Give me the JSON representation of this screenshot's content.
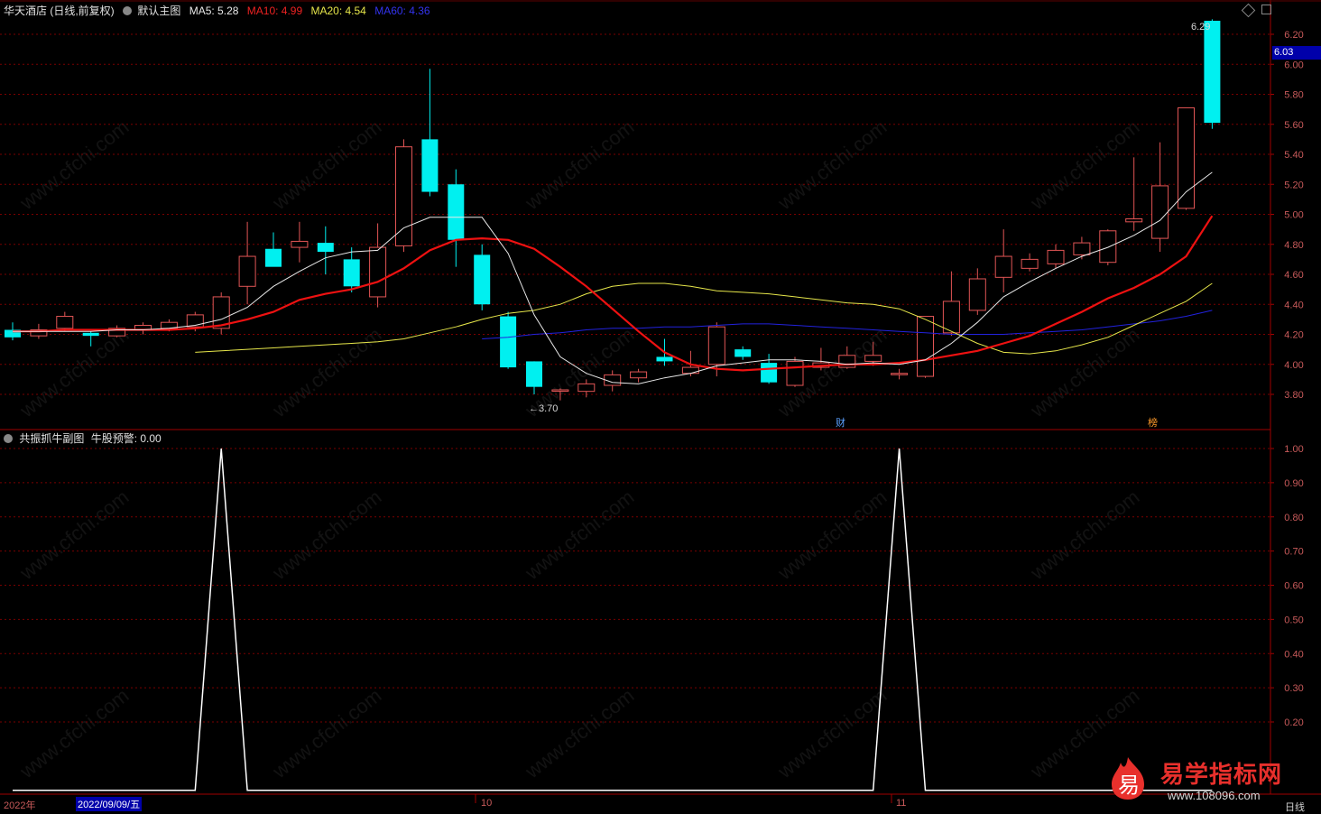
{
  "main_header": {
    "stock_title": "华天酒店 (日线,前复权)",
    "chart_name": "默认主图",
    "ma5_label": "MA5: 5.28",
    "ma10_label": "MA10: 4.99",
    "ma20_label": "MA20: 4.54",
    "ma60_label": "MA60: 4.36"
  },
  "sub_header": {
    "indicator_name": "共振抓牛副图",
    "indicator_value": "牛股预警: 0.00"
  },
  "bottom_axis": {
    "year_label": "2022年",
    "cursor_date": "2022/09/09/五",
    "month_oct": "10",
    "month_nov": "11",
    "period_label": "日线"
  },
  "price_tag": {
    "current": "6.03"
  },
  "annotations": {
    "low": "←3.70",
    "high": "6.29",
    "badge_cai": "财",
    "badge_bang": "榜"
  },
  "watermark": "www.cfchi.com",
  "brand": {
    "logo_char": "易",
    "name": "易学指标网",
    "url": "www.108096.com"
  },
  "colors": {
    "up": "#e25555",
    "down": "#00f0f0",
    "ma5": "#e8e8e8",
    "ma10": "#ee1111",
    "ma20": "#e6e64a",
    "ma60": "#2222dd",
    "grid": "#7a0000"
  },
  "chart_data": [
    {
      "type": "candlestick",
      "title": "华天酒店 (日线,前复权)",
      "ylim": [
        3.7,
        6.3
      ],
      "y_ticks": [
        "6.20",
        "6.00",
        "5.80",
        "5.60",
        "5.40",
        "5.20",
        "5.00",
        "4.80",
        "4.60",
        "4.40",
        "4.20",
        "4.00",
        "3.80"
      ],
      "candles_ohlc": [
        [
          4.23,
          4.18,
          4.28,
          4.16
        ],
        [
          4.19,
          4.23,
          4.27,
          4.17
        ],
        [
          4.24,
          4.32,
          4.35,
          4.22
        ],
        [
          4.21,
          4.19,
          4.22,
          4.12
        ],
        [
          4.19,
          4.24,
          4.26,
          4.18
        ],
        [
          4.23,
          4.26,
          4.28,
          4.2
        ],
        [
          4.24,
          4.28,
          4.3,
          4.22
        ],
        [
          4.25,
          4.33,
          4.35,
          4.22
        ],
        [
          4.24,
          4.45,
          4.48,
          4.2
        ],
        [
          4.52,
          4.72,
          4.95,
          4.4
        ],
        [
          4.77,
          4.65,
          4.88,
          4.7
        ],
        [
          4.78,
          4.82,
          4.95,
          4.68
        ],
        [
          4.81,
          4.75,
          4.92,
          4.6
        ],
        [
          4.7,
          4.52,
          4.78,
          4.48
        ],
        [
          4.45,
          4.78,
          4.94,
          4.38
        ],
        [
          4.79,
          5.45,
          5.5,
          4.75
        ],
        [
          5.5,
          5.15,
          5.97,
          5.12
        ],
        [
          5.2,
          4.83,
          5.3,
          4.65
        ],
        [
          4.73,
          4.4,
          4.8,
          4.36
        ],
        [
          4.32,
          3.98,
          4.35,
          3.97
        ],
        [
          4.02,
          3.85,
          4.02,
          3.8
        ],
        [
          3.83,
          3.83,
          3.84,
          3.76
        ],
        [
          3.82,
          3.87,
          3.9,
          3.78
        ],
        [
          3.86,
          3.93,
          3.96,
          3.82
        ],
        [
          3.91,
          3.95,
          3.97,
          3.88
        ],
        [
          4.05,
          4.02,
          4.17,
          3.99
        ],
        [
          3.94,
          3.98,
          4.09,
          3.92
        ],
        [
          4.0,
          4.25,
          4.28,
          3.92
        ],
        [
          4.1,
          4.05,
          4.12,
          4.03
        ],
        [
          4.01,
          3.88,
          4.07,
          3.87
        ],
        [
          3.86,
          4.02,
          4.05,
          3.85
        ],
        [
          3.98,
          4.01,
          4.11,
          3.96
        ],
        [
          3.98,
          4.06,
          4.12,
          3.97
        ],
        [
          4.02,
          4.06,
          4.15,
          3.99
        ],
        [
          3.94,
          3.94,
          3.97,
          3.9
        ],
        [
          3.92,
          4.32,
          4.32,
          3.91
        ],
        [
          4.21,
          4.42,
          4.62,
          4.19
        ],
        [
          4.36,
          4.57,
          4.64,
          4.33
        ],
        [
          4.58,
          4.72,
          4.9,
          4.48
        ],
        [
          4.64,
          4.7,
          4.74,
          4.62
        ],
        [
          4.67,
          4.76,
          4.8,
          4.64
        ],
        [
          4.73,
          4.81,
          4.85,
          4.7
        ],
        [
          4.68,
          4.89,
          4.9,
          4.66
        ],
        [
          4.95,
          4.97,
          5.38,
          4.89
        ],
        [
          4.84,
          5.19,
          5.48,
          4.75
        ],
        [
          5.04,
          5.71,
          5.7,
          5.03
        ],
        [
          6.29,
          5.61,
          6.3,
          5.57
        ]
      ],
      "ma5": [
        4.22,
        4.22,
        4.22,
        4.22,
        4.23,
        4.23,
        4.24,
        4.26,
        4.3,
        4.38,
        4.52,
        4.62,
        4.71,
        4.75,
        4.76,
        4.91,
        4.98,
        4.98,
        4.98,
        4.74,
        4.33,
        4.05,
        3.94,
        3.88,
        3.87,
        3.91,
        3.94,
        3.99,
        4.01,
        4.03,
        4.03,
        4.02,
        4.0,
        4.01,
        4.0,
        4.03,
        4.14,
        4.28,
        4.45,
        4.55,
        4.64,
        4.72,
        4.78,
        4.86,
        4.96,
        5.15,
        5.28
      ],
      "ma10": [
        4.22,
        4.22,
        4.23,
        4.23,
        4.23,
        4.23,
        4.23,
        4.24,
        4.26,
        4.3,
        4.35,
        4.43,
        4.47,
        4.5,
        4.55,
        4.64,
        4.76,
        4.83,
        4.84,
        4.83,
        4.77,
        4.65,
        4.52,
        4.37,
        4.22,
        4.08,
        4.0,
        3.97,
        3.96,
        3.97,
        3.98,
        3.99,
        4.0,
        4.0,
        4.01,
        4.03,
        4.06,
        4.09,
        4.14,
        4.19,
        4.27,
        4.35,
        4.44,
        4.51,
        4.6,
        4.72,
        4.99
      ],
      "ma20": [
        4.08,
        4.09,
        4.1,
        4.11,
        4.12,
        4.13,
        4.14,
        4.15,
        4.17,
        4.21,
        4.25,
        4.3,
        4.34,
        4.36,
        4.4,
        4.47,
        4.52,
        4.54,
        4.54,
        4.52,
        4.49,
        4.48,
        4.47,
        4.45,
        4.43,
        4.41,
        4.4,
        4.37,
        4.3,
        4.22,
        4.14,
        4.08,
        4.07,
        4.09,
        4.13,
        4.18,
        4.26,
        4.34,
        4.42,
        4.54
      ],
      "ma60": [
        4.17,
        4.18,
        4.2,
        4.21,
        4.23,
        4.24,
        4.24,
        4.25,
        4.25,
        4.26,
        4.27,
        4.27,
        4.26,
        4.25,
        4.24,
        4.23,
        4.22,
        4.21,
        4.2,
        4.2,
        4.2,
        4.21,
        4.22,
        4.23,
        4.25,
        4.27,
        4.29,
        4.32,
        4.36
      ]
    },
    {
      "type": "line",
      "title": "共振抓牛副图",
      "series": [
        {
          "name": "牛股预警",
          "values": [
            0,
            0,
            0,
            0,
            0,
            0,
            0,
            0,
            1,
            0,
            0,
            0,
            0,
            0,
            0,
            0,
            0,
            0,
            0,
            0,
            0,
            0,
            0,
            0,
            0,
            0,
            0,
            0,
            0,
            0,
            0,
            0,
            0,
            0,
            1,
            0,
            0,
            0,
            0,
            0,
            0,
            0,
            0,
            0,
            0,
            0,
            0
          ]
        }
      ],
      "ylim": [
        0,
        1.0
      ],
      "y_ticks": [
        "1.00",
        "0.90",
        "0.80",
        "0.70",
        "0.60",
        "0.50",
        "0.40",
        "0.30",
        "0.20"
      ]
    }
  ]
}
